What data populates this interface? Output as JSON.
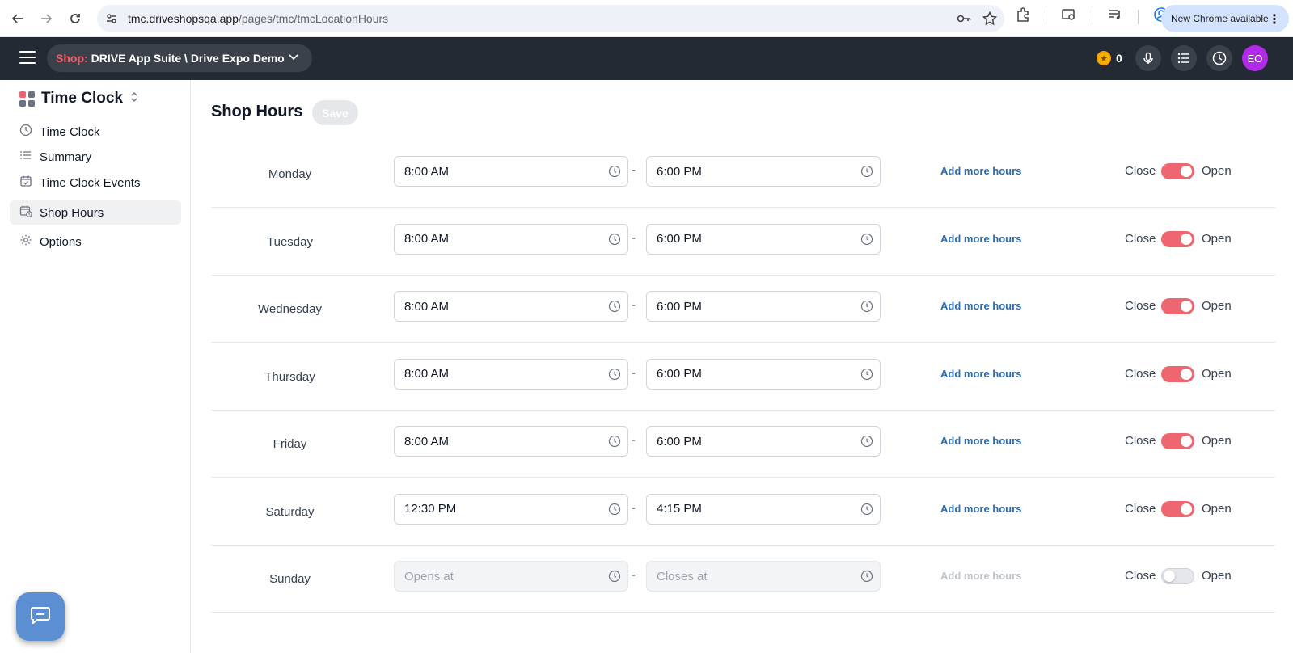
{
  "browser": {
    "url_host": "tmc.driveshopsqa.app",
    "url_path": "/pages/tmc/tmcLocationHours",
    "new_chrome_label": "New Chrome available"
  },
  "header": {
    "shop_prefix": "Shop:",
    "shop_name": "DRIVE App Suite \\ Drive Expo Demo",
    "coin_count": "0",
    "avatar_initials": "EO",
    "accent_color": "#ee6670"
  },
  "sidebar": {
    "app_title": "Time Clock",
    "items": [
      {
        "label": "Time Clock",
        "icon": "clock-icon"
      },
      {
        "label": "Summary",
        "icon": "list-icon"
      },
      {
        "label": "Time Clock Events",
        "icon": "calendar-check-icon"
      },
      {
        "label": "Shop Hours",
        "icon": "calendar-clock-icon",
        "active": true
      },
      {
        "label": "Options",
        "icon": "gear-icon"
      }
    ]
  },
  "main": {
    "title": "Shop Hours",
    "save_label": "Save",
    "separator": "-",
    "add_more_label": "Add more hours",
    "close_label": "Close",
    "open_label": "Open",
    "opens_placeholder": "Opens at",
    "closes_placeholder": "Closes at",
    "days": [
      {
        "day": "Monday",
        "open": "8:00 AM",
        "close": "6:00 PM",
        "enabled": true
      },
      {
        "day": "Tuesday",
        "open": "8:00 AM",
        "close": "6:00 PM",
        "enabled": true
      },
      {
        "day": "Wednesday",
        "open": "8:00 AM",
        "close": "6:00 PM",
        "enabled": true
      },
      {
        "day": "Thursday",
        "open": "8:00 AM",
        "close": "6:00 PM",
        "enabled": true
      },
      {
        "day": "Friday",
        "open": "8:00 AM",
        "close": "6:00 PM",
        "enabled": true
      },
      {
        "day": "Saturday",
        "open": "12:30 PM",
        "close": "4:15 PM",
        "enabled": true
      },
      {
        "day": "Sunday",
        "open": "",
        "close": "",
        "enabled": false
      }
    ]
  }
}
